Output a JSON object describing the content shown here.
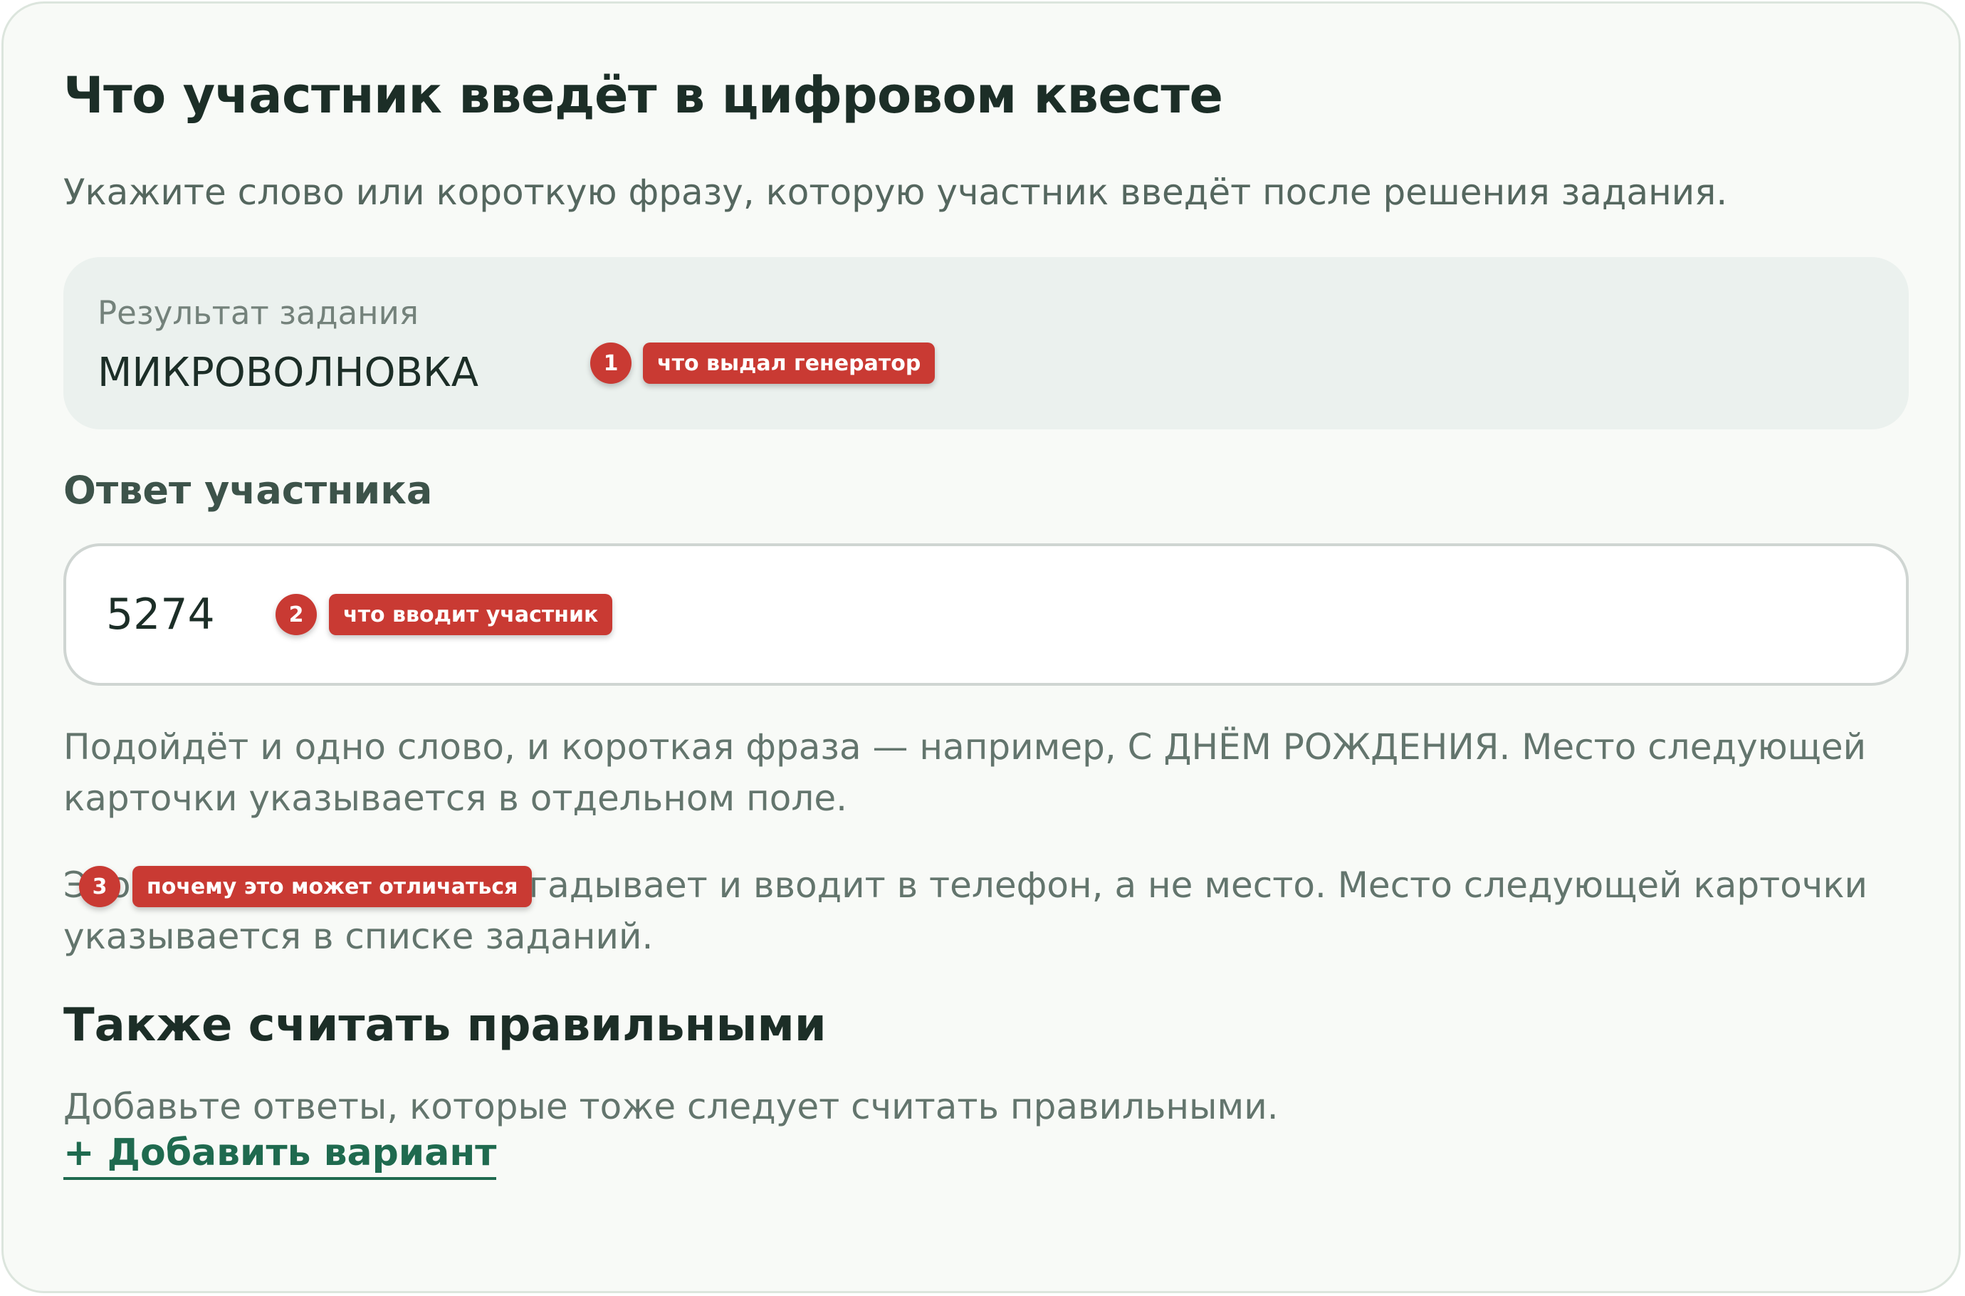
{
  "title": "Что участник введёт в цифровом квесте",
  "subtitle": "Укажите слово или короткую фразу, которую участник введёт после решения задания.",
  "result": {
    "label": "Результат задания",
    "value": "МИКРОВОЛНОВКА"
  },
  "answer": {
    "label": "Ответ участника",
    "value": "5274"
  },
  "hints": {
    "first": "Подойдёт и одно слово, и короткая фраза — например, С ДНЁМ РОЖДЕНИЯ. Место следующей карточки указывается в отдельном поле.",
    "second": "Это то, что участник разгадывает и вводит в телефон, а не место. Место следующей карточки указывается в списке заданий."
  },
  "alternatives": {
    "title": "Также считать правильными",
    "description": "Добавьте ответы, которые тоже следует считать правильными.",
    "add_label": "+ Добавить вариант"
  },
  "annotations": [
    {
      "number": "1",
      "text": "что выдал генератор"
    },
    {
      "number": "2",
      "text": "что вводит участник"
    },
    {
      "number": "3",
      "text": "почему это может отличаться"
    }
  ],
  "colors": {
    "card_background": "#f8faf7",
    "result_background": "#ebf1ee",
    "heading": "#1c2e27",
    "muted_text": "#63756d",
    "link": "#1f6a4f",
    "annotation": "#c93a33"
  }
}
